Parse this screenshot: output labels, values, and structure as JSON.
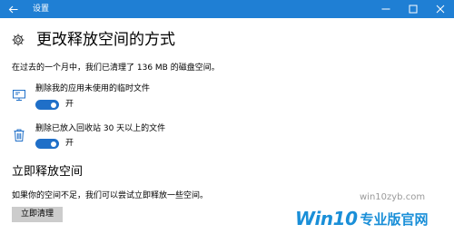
{
  "window": {
    "title": "设置",
    "back_icon": "back-arrow-icon",
    "minimize_icon": "minimize-icon",
    "maximize_icon": "maximize-icon",
    "close_icon": "close-icon"
  },
  "header": {
    "icon": "gear-icon",
    "title": "更改释放空间的方式"
  },
  "description": "在过去的一个月中，我们已清理了 136 MB 的磁盘空间。",
  "options": [
    {
      "icon": "temp-files-icon",
      "label": "删除我的应用未使用的临时文件",
      "state": "开",
      "on": true
    },
    {
      "icon": "recycle-bin-icon",
      "label": "删除已放入回收站 30 天以上的文件",
      "state": "开",
      "on": true
    }
  ],
  "free_now": {
    "title": "立即释放空间",
    "description": "如果你的空间不足，我们可以尝试立即释放一些空间。",
    "button_label": "立即清理"
  },
  "watermark": {
    "url": "win10zyb.com",
    "brand": "Win10",
    "brand_cn": "专业版官网"
  },
  "colors": {
    "titlebar": "#1f7fd4",
    "toggle_on": "#1f6fc8",
    "button_bg": "#cccccc",
    "watermark": "#1a8fd8"
  }
}
